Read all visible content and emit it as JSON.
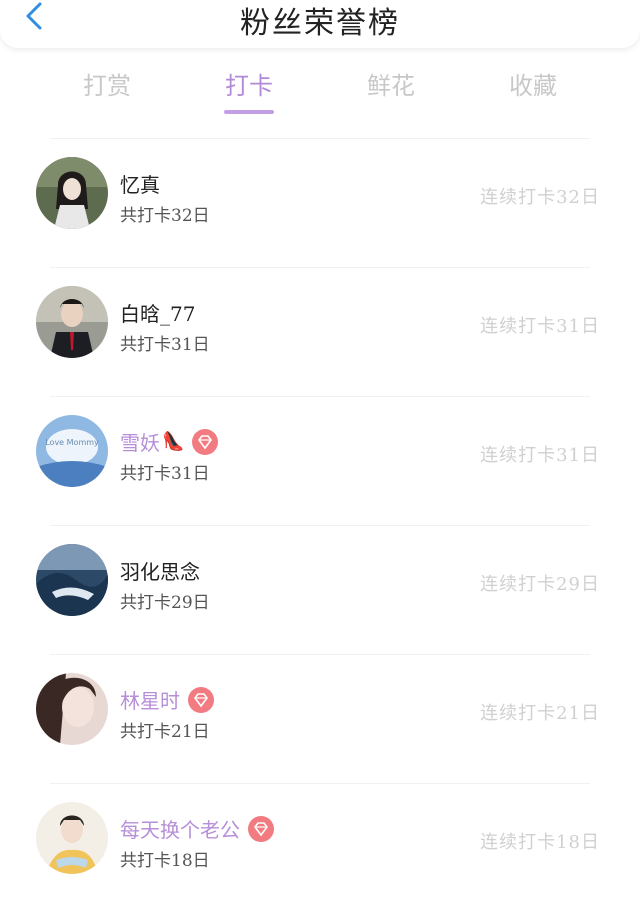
{
  "header": {
    "title": "粉丝荣誉榜"
  },
  "tabs": [
    {
      "label": "打赏"
    },
    {
      "label": "打卡"
    },
    {
      "label": "鲜花"
    },
    {
      "label": "收藏"
    }
  ],
  "active_tab": "打卡",
  "rows": [
    {
      "name": "忆真",
      "total": "共打卡32日",
      "streak": "连续打卡32日",
      "vip": false
    },
    {
      "name": "白晗_77",
      "total": "共打卡31日",
      "streak": "连续打卡31日",
      "vip": false
    },
    {
      "name": "雪妖",
      "total": "共打卡31日",
      "streak": "连续打卡31日",
      "vip": true
    },
    {
      "name": "羽化思念",
      "total": "共打卡29日",
      "streak": "连续打卡29日",
      "vip": false
    },
    {
      "name": "林星时",
      "total": "共打卡21日",
      "streak": "连续打卡21日",
      "vip": true
    },
    {
      "name": "每天换个老公",
      "total": "共打卡18日",
      "streak": "连续打卡18日",
      "vip": true
    }
  ],
  "colors": {
    "accent": "#b38ad8",
    "badge": "#f27b82"
  },
  "avatar_labels": {
    "row3": "Love Mommy"
  }
}
